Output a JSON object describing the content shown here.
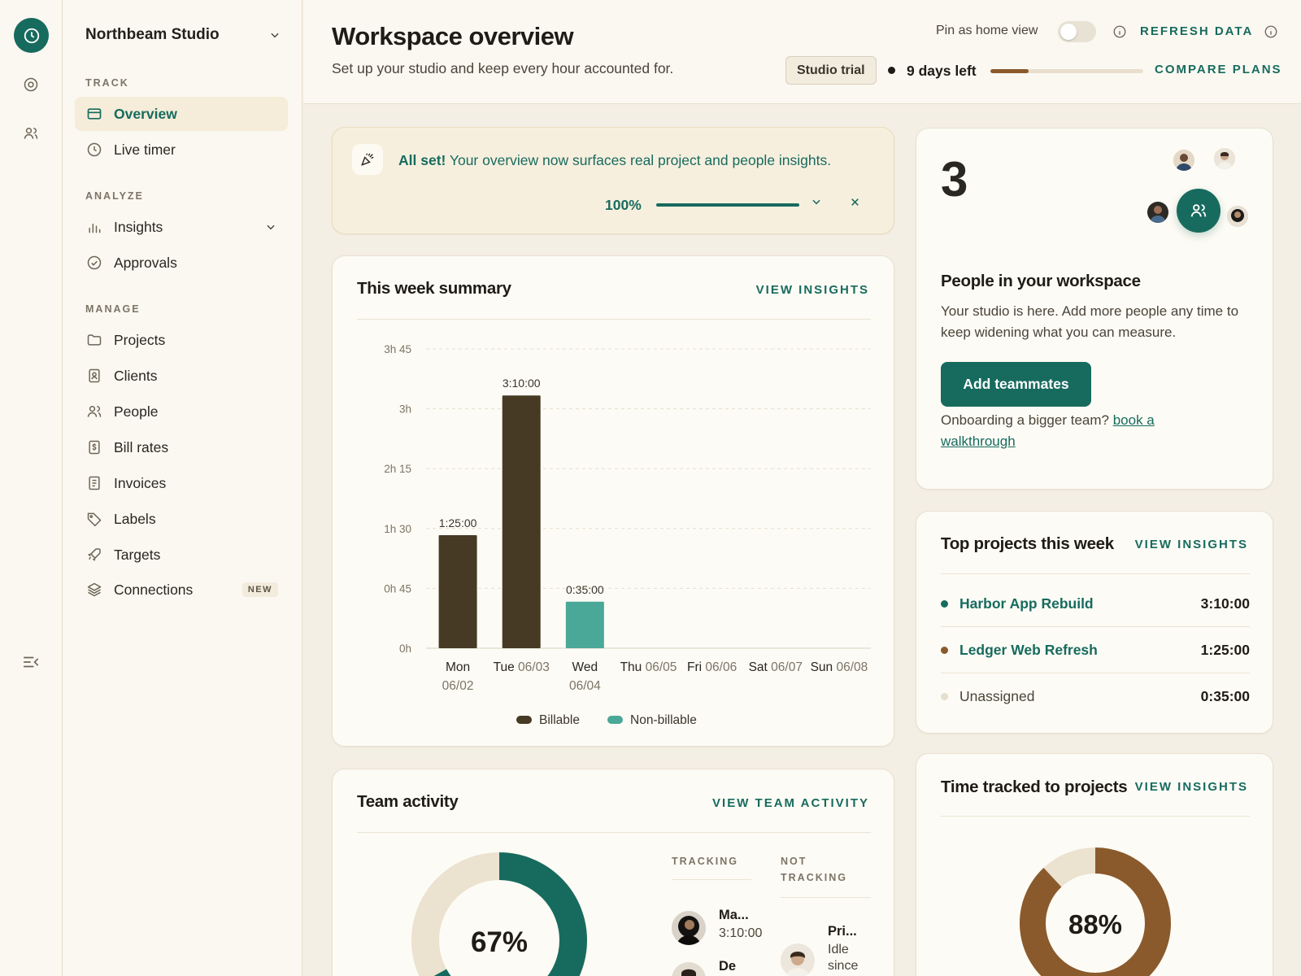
{
  "workspace": {
    "name": "Northbeam Studio"
  },
  "sidebar": {
    "sections": [
      {
        "label": "TRACK",
        "items": [
          {
            "label": "Overview",
            "icon": "card-icon",
            "active": true
          },
          {
            "label": "Live timer",
            "icon": "clock-icon"
          }
        ]
      },
      {
        "label": "ANALYZE",
        "items": [
          {
            "label": "Insights",
            "icon": "bar-chart-icon",
            "expandable": true
          },
          {
            "label": "Approvals",
            "icon": "check-circle-icon"
          }
        ]
      },
      {
        "label": "MANAGE",
        "items": [
          {
            "label": "Projects",
            "icon": "folder-icon"
          },
          {
            "label": "Clients",
            "icon": "contact-card-icon"
          },
          {
            "label": "People",
            "icon": "people-icon"
          },
          {
            "label": "Bill rates",
            "icon": "dollar-icon"
          },
          {
            "label": "Invoices",
            "icon": "invoice-icon"
          },
          {
            "label": "Labels",
            "icon": "tag-icon"
          },
          {
            "label": "Targets",
            "icon": "rocket-icon"
          },
          {
            "label": "Connections",
            "icon": "layers-icon",
            "badge": "NEW"
          }
        ]
      }
    ]
  },
  "header": {
    "title": "Workspace overview",
    "subtitle": "Set up your studio and keep every hour accounted for.",
    "pin_label": "Pin as home view",
    "pin_enabled": false,
    "refresh_label": "REFRESH DATA",
    "trial_label": "Studio trial",
    "days_left": "9 days left",
    "trial_progress": 0.25,
    "compare_label": "COMPARE PLANS"
  },
  "banner": {
    "strong": "All set!",
    "text": " Your overview now surfaces real project and people insights.",
    "progress_label": "100%",
    "progress": 1.0
  },
  "summary": {
    "title": "This week summary",
    "link": "VIEW INSIGHTS",
    "legend": {
      "billable": "Billable",
      "non_billable": "Non-billable"
    }
  },
  "chart_data": {
    "type": "bar",
    "stacked": true,
    "categories": [
      "Mon 06/02",
      "Tue 06/03",
      "Wed 06/04",
      "Thu 06/05",
      "Fri 06/06",
      "Sat 06/07",
      "Sun 06/08"
    ],
    "day_names": [
      "Mon",
      "Tue",
      "Wed",
      "Thu",
      "Fri",
      "Sat",
      "Sun"
    ],
    "day_dates": [
      "06/02",
      "06/03",
      "06/04",
      "06/05",
      "06/06",
      "06/07",
      "06/08"
    ],
    "series": [
      {
        "name": "Billable",
        "color": "#463a24",
        "values_minutes": [
          85,
          190,
          0,
          0,
          0,
          0,
          0
        ]
      },
      {
        "name": "Non-billable",
        "color": "#4aa898",
        "values_minutes": [
          0,
          0,
          35,
          0,
          0,
          0,
          0
        ]
      }
    ],
    "bar_labels": [
      "1:25:00",
      "3:10:00",
      "0:35:00",
      "",
      "",
      "",
      ""
    ],
    "y_ticks_minutes": [
      0,
      45,
      90,
      135,
      180,
      225
    ],
    "y_tick_labels": [
      "0h",
      "0h 45",
      "1h 30",
      "2h 15",
      "3h",
      "3h 45"
    ],
    "ylim_minutes": [
      0,
      225
    ],
    "grid": true,
    "legend_position": "bottom-center"
  },
  "people": {
    "count": "3",
    "title": "People in your workspace",
    "description": "Your studio is here. Add more people any time to keep widening what you can measure.",
    "button": "Add teammates",
    "onboard_text": "Onboarding a bigger team? ",
    "onboard_link": "book a walkthrough"
  },
  "top_projects": {
    "title": "Top projects this week",
    "link": "VIEW INSIGHTS",
    "rows": [
      {
        "name": "Harbor App Rebuild",
        "time": "3:10:00",
        "color": "#176b5e"
      },
      {
        "name": "Ledger Web Refresh",
        "time": "1:25:00",
        "color": "#8a5a2c"
      },
      {
        "name": "Unassigned",
        "time": "0:35:00",
        "color": "#e6dfcf"
      }
    ]
  },
  "team": {
    "title": "Team activity",
    "link": "VIEW TEAM ACTIVITY",
    "donut_label": "67%",
    "donut_value": 0.67,
    "tracking_header": "TRACKING",
    "not_tracking_header_1": "NOT",
    "not_tracking_header_2": "TRACKING",
    "tracking": [
      {
        "name": "Ma...",
        "sub": "3:10:00"
      },
      {
        "name": "De",
        "sub": ""
      }
    ],
    "not_tracking": [
      {
        "name": "Pri...",
        "sub1": "Idle",
        "sub2": "since"
      }
    ]
  },
  "tracked": {
    "title": "Time tracked to projects",
    "link": "VIEW INSIGHTS",
    "donut_label": "88%",
    "donut_value": 0.88
  },
  "colors": {
    "accent": "#176b5e",
    "brown": "#8a5a2c",
    "bar_dark": "#463a24",
    "bar_teal": "#4aa898"
  }
}
